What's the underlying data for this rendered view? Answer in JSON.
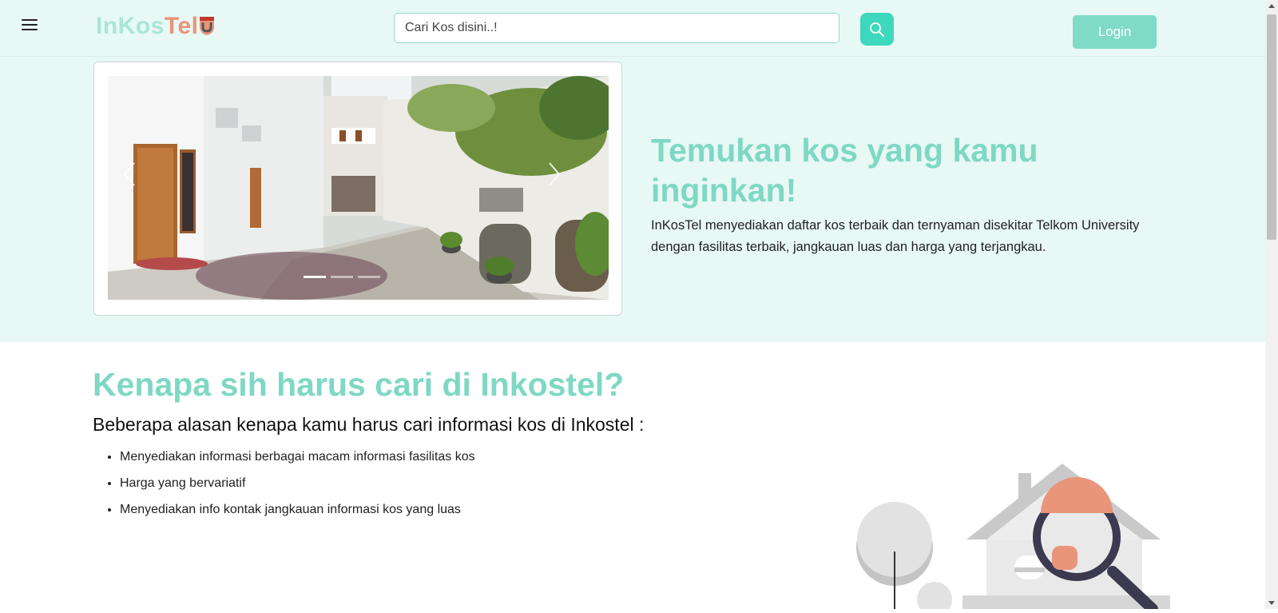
{
  "navbar": {
    "menu_icon": "hamburger-menu-icon",
    "logo": {
      "part1": "InKos",
      "part2": "Tel",
      "emblem_icon": "telkom-shield-icon"
    },
    "search": {
      "placeholder": "Cari Kos disini..!",
      "value": "",
      "button_icon": "search-icon"
    },
    "login_label": "Login"
  },
  "hero": {
    "carousel": {
      "prev_icon": "chevron-left-icon",
      "next_icon": "chevron-right-icon",
      "slides": 3,
      "active_slide": 1
    },
    "title": "Temukan kos yang kamu inginkan!",
    "description": "InKosTel menyediakan daftar kos terbaik dan ternyaman disekitar Telkom University dengan fasilitas terbaik, jangkauan luas dan harga yang terjangkau."
  },
  "why": {
    "title": "Kenapa sih harus cari di Inkostel?",
    "subtitle": "Beberapa alasan kenapa kamu harus cari informasi kos di Inkostel :",
    "reasons": [
      "Menyediakan informasi berbagai macam informasi fasilitas kos",
      "Harga yang bervariatif",
      "Menyediakan info kontak jangkauan informasi kos yang luas"
    ],
    "illustration": "house-magnifier-illustration"
  },
  "colors": {
    "accent": "#7ed8c4",
    "hero_bg": "#e8f8f4",
    "search_btn": "#3ed8bd",
    "login_btn": "#7fdac6",
    "logo_secondary": "#e8957a"
  }
}
